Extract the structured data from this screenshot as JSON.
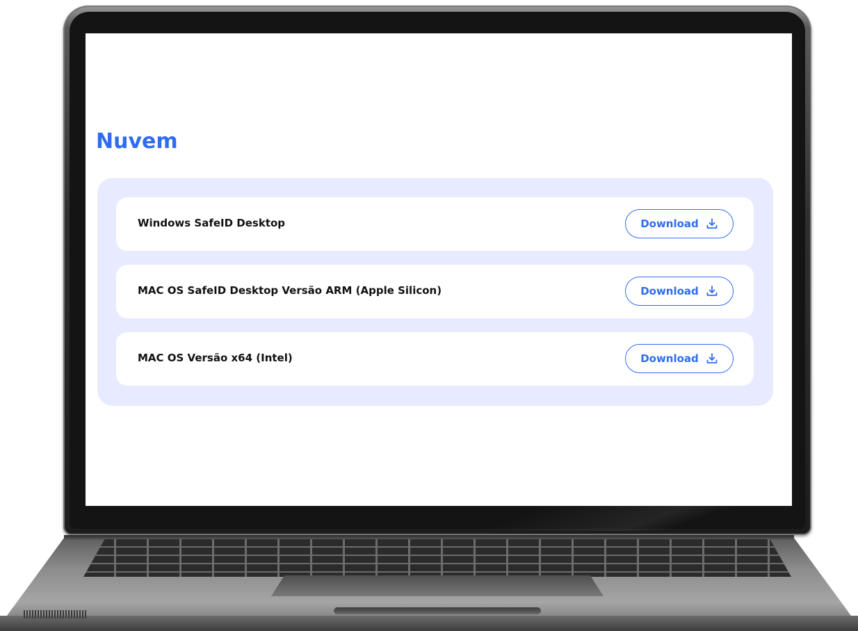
{
  "page": {
    "title": "Nuvem"
  },
  "downloads": [
    {
      "label": "Windows SafeID Desktop",
      "button_label": "Download",
      "icon": "download-icon"
    },
    {
      "label": "MAC OS SafeID Desktop Versão ARM (Apple Silicon)",
      "button_label": "Download",
      "icon": "download-icon"
    },
    {
      "label": "MAC OS Versão x64 (Intel)",
      "button_label": "Download",
      "icon": "download-icon"
    }
  ],
  "colors": {
    "accent": "#2f6cf0",
    "panel_background": "#e8ebff",
    "row_background": "#ffffff",
    "label_text": "#111111"
  }
}
